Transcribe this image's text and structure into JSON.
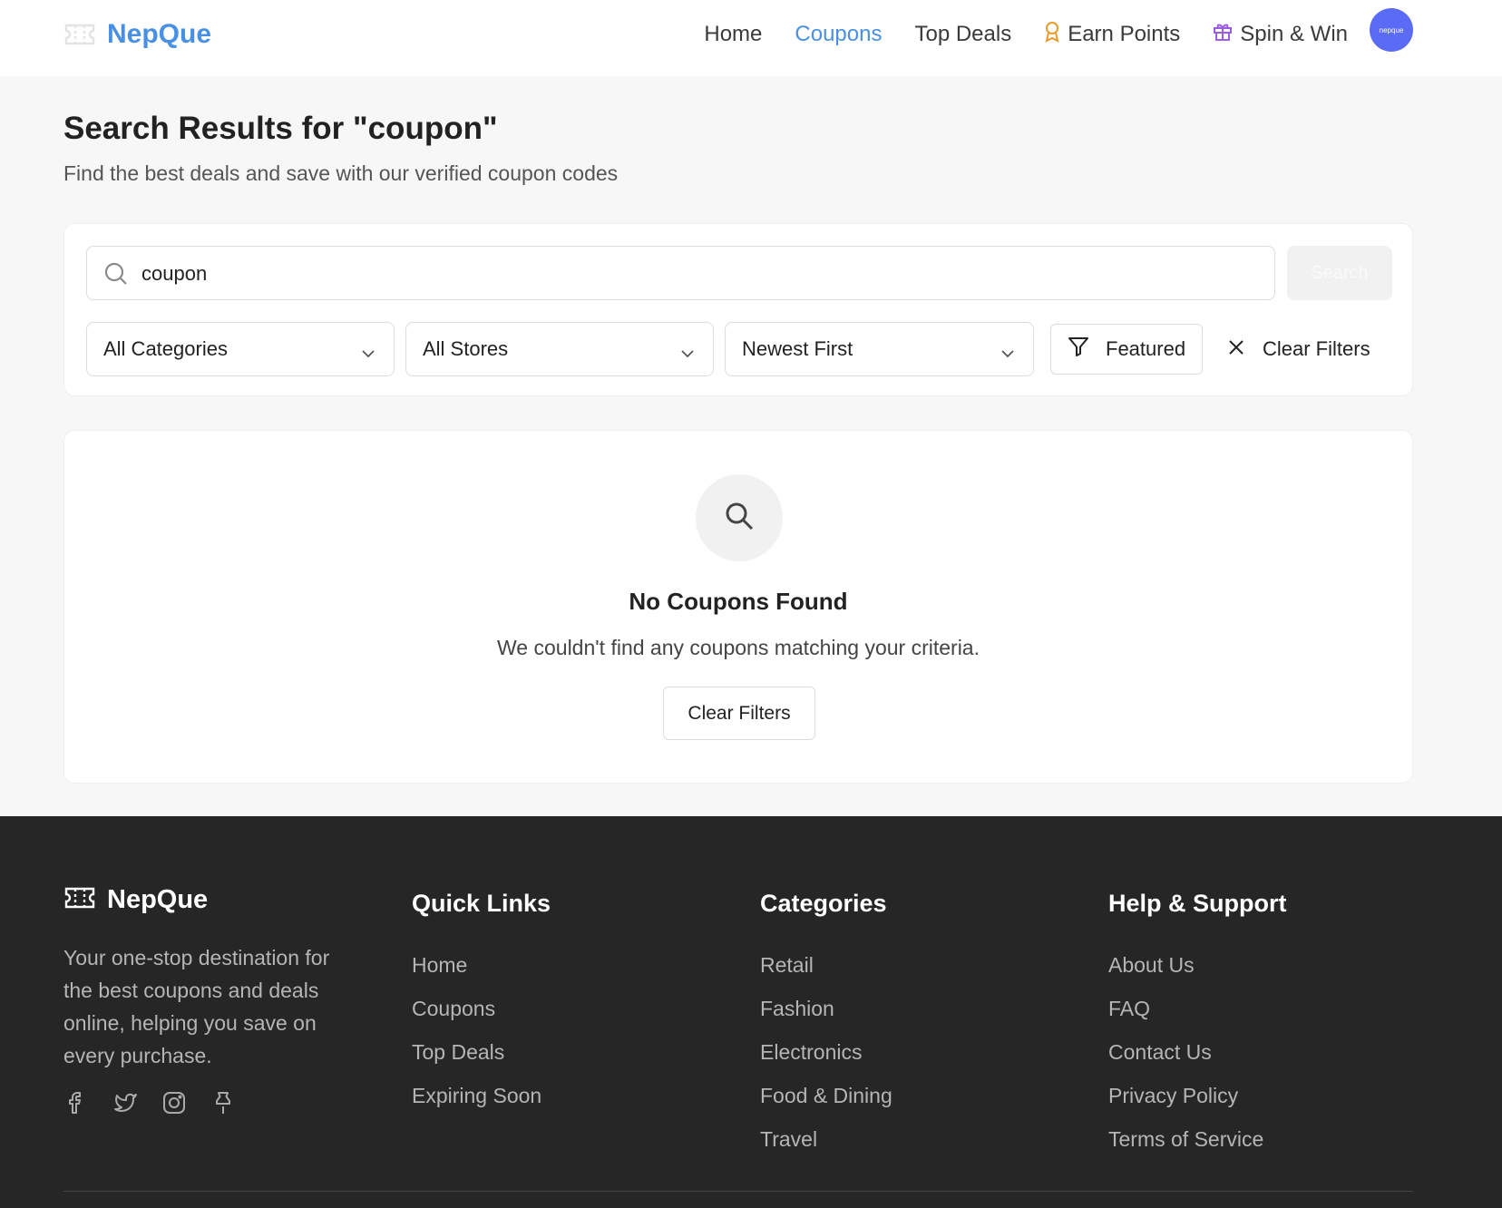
{
  "header": {
    "brand": "NepQue",
    "nav": [
      {
        "label": "Home",
        "icon": null,
        "active": false
      },
      {
        "label": "Coupons",
        "icon": null,
        "active": true
      },
      {
        "label": "Top Deals",
        "icon": null,
        "active": false
      },
      {
        "label": "Earn Points",
        "icon": "award-icon",
        "active": false
      },
      {
        "label": "Spin & Win",
        "icon": "gift-icon",
        "active": false
      }
    ],
    "avatar_text": "nepque"
  },
  "page": {
    "title": "Search Results for \"coupon\"",
    "subtitle": "Find the best deals and save with our verified coupon codes"
  },
  "search": {
    "value": "coupon",
    "button_label": "Search",
    "filters": {
      "category": "All Categories",
      "store": "All Stores",
      "sort": "Newest First",
      "featured_label": "Featured",
      "clear_label": "Clear Filters"
    }
  },
  "empty_state": {
    "title": "No Coupons Found",
    "message": "We couldn't find any coupons matching your criteria.",
    "button_label": "Clear Filters"
  },
  "footer": {
    "brand": "NepQue",
    "description": "Your one-stop destination for the best coupons and deals online, helping you save on every purchase.",
    "socials": [
      "facebook-icon",
      "twitter-icon",
      "instagram-icon",
      "pin-icon"
    ],
    "quick_links": {
      "title": "Quick Links",
      "items": [
        "Home",
        "Coupons",
        "Top Deals",
        "Expiring Soon"
      ]
    },
    "categories": {
      "title": "Categories",
      "items": [
        "Retail",
        "Fashion",
        "Electronics",
        "Food & Dining",
        "Travel"
      ]
    },
    "help": {
      "title": "Help & Support",
      "items": [
        "About Us",
        "FAQ",
        "Contact Us",
        "Privacy Policy",
        "Terms of Service"
      ]
    }
  },
  "colors": {
    "accent": "#4a90e2",
    "avatar_bg": "#5a6cf5",
    "footer_bg": "#262626",
    "earn_points_icon": "#e89a2c",
    "spin_win_icon": "#9b5de5"
  }
}
